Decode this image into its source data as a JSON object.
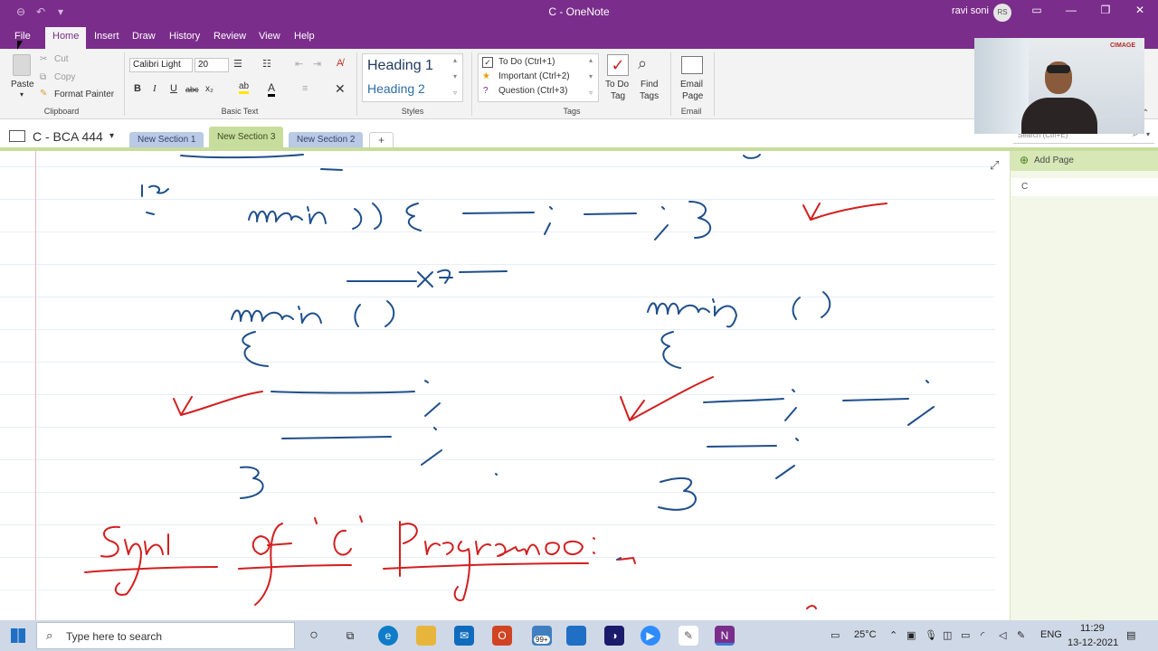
{
  "titlebar": {
    "title": "C  -  OneNote",
    "user_name": "ravi soni",
    "user_initials": "RS"
  },
  "ribbon_tabs": [
    "File",
    "Home",
    "Insert",
    "Draw",
    "History",
    "Review",
    "View",
    "Help"
  ],
  "clipboard": {
    "paste": "Paste",
    "cut": "Cut",
    "copy": "Copy",
    "format_painter": "Format Painter",
    "label": "Clipboard"
  },
  "basic_text": {
    "font": "Calibri Light",
    "size": "20",
    "bold": "B",
    "italic": "I",
    "underline": "U",
    "strike": "abc",
    "subscript": "x₂",
    "label": "Basic Text"
  },
  "styles": {
    "heading1": "Heading 1",
    "heading2": "Heading 2",
    "label": "Styles"
  },
  "tags": {
    "todo": "To Do (Ctrl+1)",
    "important": "Important (Ctrl+2)",
    "question": "Question (Ctrl+3)",
    "todo_tag_line1": "To Do",
    "todo_tag_line2": "Tag",
    "find_tags_line1": "Find",
    "find_tags_line2": "Tags",
    "label": "Tags"
  },
  "email": {
    "line1": "Email",
    "line2": "Page",
    "label": "Email"
  },
  "notebook": {
    "name": "C - BCA 444",
    "sections": [
      "New Section 1",
      "New Section 3",
      "New Section 2"
    ],
    "active_section_index": 1,
    "add_section": "+"
  },
  "search": {
    "placeholder": "Search (Ctrl+E)"
  },
  "pages": {
    "add_page": "Add Page",
    "items": [
      "C"
    ]
  },
  "webcam": {
    "logo": "CIMAGE"
  },
  "taskbar": {
    "search_placeholder": "Type here to search",
    "mail_badge": "99+",
    "weather": "25°C",
    "language": "ENG",
    "time": "11:29",
    "date": "13-12-2021"
  },
  "colors": {
    "accent": "#7a2d8b",
    "section_green": "#c7dd9d",
    "ink_blue": "#1f4f8a",
    "ink_red": "#d21f1f"
  }
}
